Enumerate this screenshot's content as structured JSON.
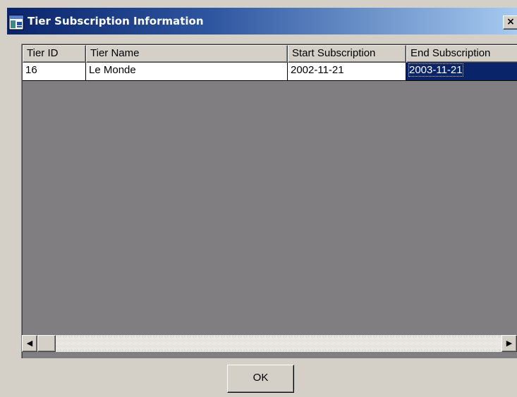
{
  "window": {
    "title": "Tier Subscription Information",
    "app_icon": "app-window-icon",
    "close_glyph": "×",
    "close_icon": "close-icon"
  },
  "grid": {
    "columns": [
      "Tier ID",
      "Tier Name",
      "Start Subscription",
      "End Subscription"
    ],
    "rows": [
      {
        "tier_id": "16",
        "tier_name": "Le Monde",
        "start_subscription": "2002-11-21",
        "end_subscription": "2003-11-21"
      }
    ],
    "selected_cell": "end_subscription",
    "selection_color": "#0a246a",
    "empty_area_color": "#807e80"
  },
  "scrollbar": {
    "left_icon": "scroll-left-arrow-icon",
    "right_icon": "scroll-right-arrow-icon",
    "left_glyph": "◀",
    "right_glyph": "▶"
  },
  "buttons": {
    "ok_label": "OK"
  },
  "colors": {
    "title_bar_start": "#0a246a",
    "title_bar_end": "#a6caf0",
    "window_face": "#d4d0c8"
  }
}
